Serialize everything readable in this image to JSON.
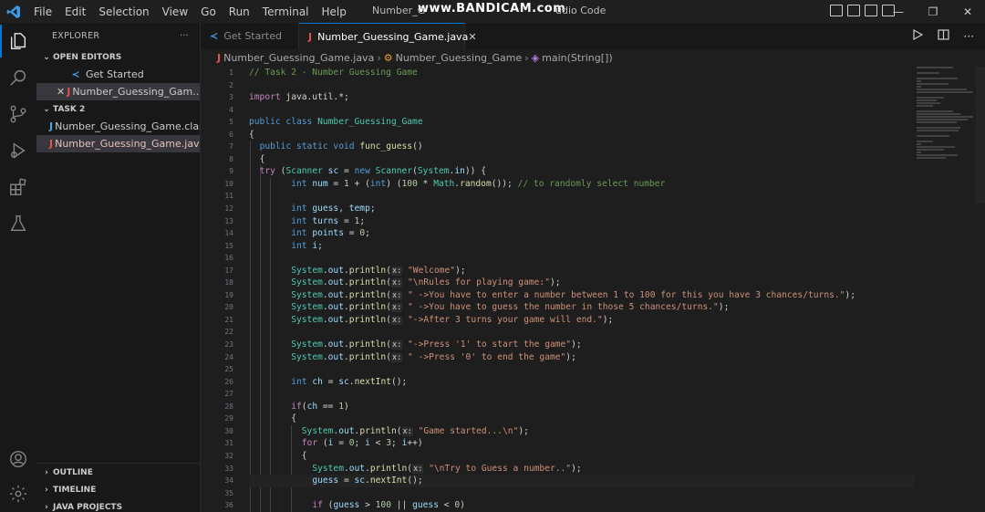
{
  "titlebar": {
    "menu": [
      "File",
      "Edit",
      "Selection",
      "View",
      "Go",
      "Run",
      "Terminal",
      "Help"
    ],
    "window_title": "Number_G",
    "window_title_suffix": "udio Code",
    "watermark": "www.BANDICAM.com",
    "controls": [
      "—",
      "❐",
      "✕"
    ]
  },
  "sidebar": {
    "title": "EXPLORER",
    "more": "···",
    "open_editors": {
      "label": "OPEN EDITORS",
      "items": [
        {
          "label": "Get Started"
        },
        {
          "label": "Number_Guessing_Gam..."
        }
      ]
    },
    "folder": {
      "label": "TASK 2",
      "items": [
        {
          "label": "Number_Guessing_Game.class"
        },
        {
          "label": "Number_Guessing_Game.java"
        }
      ]
    },
    "bottom_sections": [
      "OUTLINE",
      "TIMELINE",
      "JAVA PROJECTS"
    ]
  },
  "tabs": [
    {
      "label": "Get Started"
    },
    {
      "label": "Number_Guessing_Game.java"
    }
  ],
  "breadcrumb": {
    "file": "Number_Guessing_Game.java",
    "class": "Number_Guessing_Game",
    "method": "main(String[])"
  },
  "editor": {
    "line_numbers": [
      "1",
      "2",
      "3",
      "4",
      "5",
      "6",
      "7",
      "8",
      "9",
      "10",
      "11",
      "12",
      "13",
      "14",
      "15",
      "16",
      "17",
      "18",
      "19",
      "20",
      "21",
      "22",
      "23",
      "24",
      "25",
      "26",
      "27",
      "28",
      "29",
      "30",
      "31",
      "32",
      "33",
      "34",
      "35",
      "36"
    ],
    "hint_label": "x:",
    "lines": {
      "l1": "// Task 2 - Number Guessing Game",
      "l3a": "import",
      "l3b": " java.util.*;",
      "l5a": "public class",
      "l5b": "Number_Guessing_Game",
      "l6": "{",
      "l7a": "public static void",
      "l7b": "func_guess",
      "l7c": "()",
      "l8": "{",
      "l9a": "try",
      "l9b": " (",
      "l9c": "Scanner",
      "l9d": "sc",
      "l9e": " = ",
      "l9f": "new",
      "l9g": "Scanner",
      "l9h": "(",
      "l9i": "System",
      "l9j": ".",
      "l9k": "in",
      "l9l": ")) {",
      "l10a": "int",
      "l10b": "num",
      "l10c": " = ",
      "l10d": "1",
      "l10e": " + (",
      "l10f": "int",
      "l10g": ") (",
      "l10h": "100",
      "l10i": " * ",
      "l10j": "Math",
      "l10k": ".",
      "l10l": "random",
      "l10m": "()); ",
      "l10n": "// to randomly select number",
      "l12a": "int",
      "l12b": "guess, temp;",
      "l13a": "int",
      "l13b": "turns",
      "l13c": " = ",
      "l13d": "1",
      "l13e": ";",
      "l14a": "int",
      "l14b": "points",
      "l14c": " = ",
      "l14d": "0",
      "l14e": ";",
      "l15a": "int",
      "l15b": "i;",
      "l17s": "\"Welcome\"",
      "l18s": "\"\\nRules for playing game:\"",
      "l19s": "\" ->You have to enter a number between 1 to 100 for this you have 3 chances/turns.\"",
      "l20s": "\" ->You have to guess the number in those 5 chances/turns.\"",
      "l21s": "\"->After 3 turns your game will end.\"",
      "l23s": "\"->Press '1' to start the game\"",
      "l24s": "\" ->Press '0' to end the game\"",
      "l26a": "int",
      "l26b": "ch",
      "l26c": " = ",
      "l26d": "sc",
      "l26e": ".",
      "l26f": "nextInt",
      "l26g": "();",
      "l28a": "if",
      "l28b": "(",
      "l28c": "ch",
      "l28d": " == ",
      "l28e": "1",
      "l28f": ")",
      "l29": "{",
      "l30s": "\"Game started...\\n\"",
      "l31a": "for",
      "l31b": " (",
      "l31c": "i",
      "l31d": " = ",
      "l31e": "0",
      "l31f": "; ",
      "l31g": "i",
      "l31h": " < ",
      "l31i": "3",
      "l31j": "; ",
      "l31k": "i",
      "l31l": "++)",
      "l32": "{",
      "l33s": "\"\\nTry to Guess a number..\"",
      "l34a": "guess",
      "l34b": " = ",
      "l34c": "sc",
      "l34d": ".",
      "l34e": "nextInt",
      "l34f": "();",
      "l36a": "if",
      "l36b": " (",
      "l36c": "guess",
      "l36d": " > ",
      "l36e": "100",
      "l36f": " || ",
      "l36g": "guess",
      "l36h": " < ",
      "l36i": "0",
      "l36j": ")",
      "sys": "System",
      "out": "out",
      "println": "println",
      "dot": ".",
      "open": "(",
      "close": ");"
    }
  }
}
